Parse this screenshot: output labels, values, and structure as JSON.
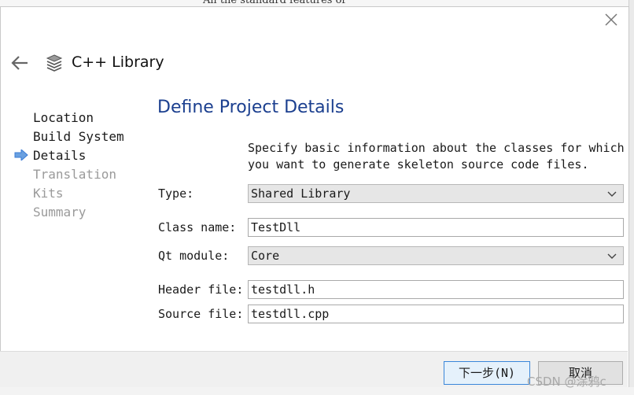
{
  "background": {
    "top_snippet": "All the standard features of"
  },
  "dialog": {
    "wizard_title": "C++ Library",
    "page_title": "Define Project Details",
    "steps": [
      {
        "label": "Location",
        "state": "done"
      },
      {
        "label": "Build System",
        "state": "done"
      },
      {
        "label": "Details",
        "state": "current"
      },
      {
        "label": "Translation",
        "state": "todo"
      },
      {
        "label": "Kits",
        "state": "todo"
      },
      {
        "label": "Summary",
        "state": "todo"
      }
    ],
    "description": "Specify basic information about the classes for which you want to generate skeleton source code files.",
    "form": {
      "type_label": "Type:",
      "type_value": "Shared Library",
      "class_label": "Class name:",
      "class_value": "TestDll",
      "qt_label": "Qt module:",
      "qt_value": "Core",
      "header_label": "Header file:",
      "header_value": "testdll.h",
      "source_label": "Source file:",
      "source_value": "testdll.cpp"
    },
    "buttons": {
      "next": "下一步(N)",
      "cancel": "取消"
    }
  },
  "watermark": "CSDN @涂鸦c",
  "colors": {
    "title_blue": "#1b3f8f",
    "current_arrow": "#3a7bd5",
    "default_button_border": "#3a86d9"
  }
}
